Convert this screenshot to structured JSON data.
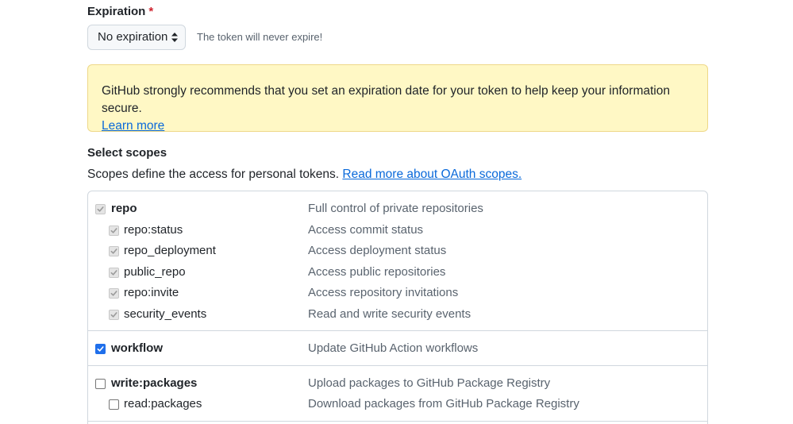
{
  "expiration": {
    "label": "Expiration",
    "required_mark": "*",
    "selected": "No expiration",
    "note": "The token will never expire!"
  },
  "warning": {
    "text": "GitHub strongly recommends that you set an expiration date for your token to help keep your information secure.",
    "link": "Learn more"
  },
  "scopes": {
    "heading": "Select scopes",
    "description": "Scopes define the access for personal tokens.",
    "link": "Read more about OAuth scopes.",
    "groups": [
      {
        "parent": {
          "name": "repo",
          "desc": "Full control of private repositories",
          "state": "checked-disabled"
        },
        "children": [
          {
            "name": "repo:status",
            "desc": "Access commit status",
            "state": "checked-disabled"
          },
          {
            "name": "repo_deployment",
            "desc": "Access deployment status",
            "state": "checked-disabled"
          },
          {
            "name": "public_repo",
            "desc": "Access public repositories",
            "state": "checked-disabled"
          },
          {
            "name": "repo:invite",
            "desc": "Access repository invitations",
            "state": "checked-disabled"
          },
          {
            "name": "security_events",
            "desc": "Read and write security events",
            "state": "checked-disabled"
          }
        ]
      },
      {
        "parent": {
          "name": "workflow",
          "desc": "Update GitHub Action workflows",
          "state": "checked"
        },
        "children": []
      },
      {
        "parent": {
          "name": "write:packages",
          "desc": "Upload packages to GitHub Package Registry",
          "state": "unchecked"
        },
        "children": [
          {
            "name": "read:packages",
            "desc": "Download packages from GitHub Package Registry",
            "state": "unchecked"
          }
        ]
      }
    ]
  },
  "colors": {
    "accent": "#0969da",
    "checkbox_checked": "#1f6feb",
    "warning_bg": "#fff8c5",
    "required": "#cf222e"
  }
}
